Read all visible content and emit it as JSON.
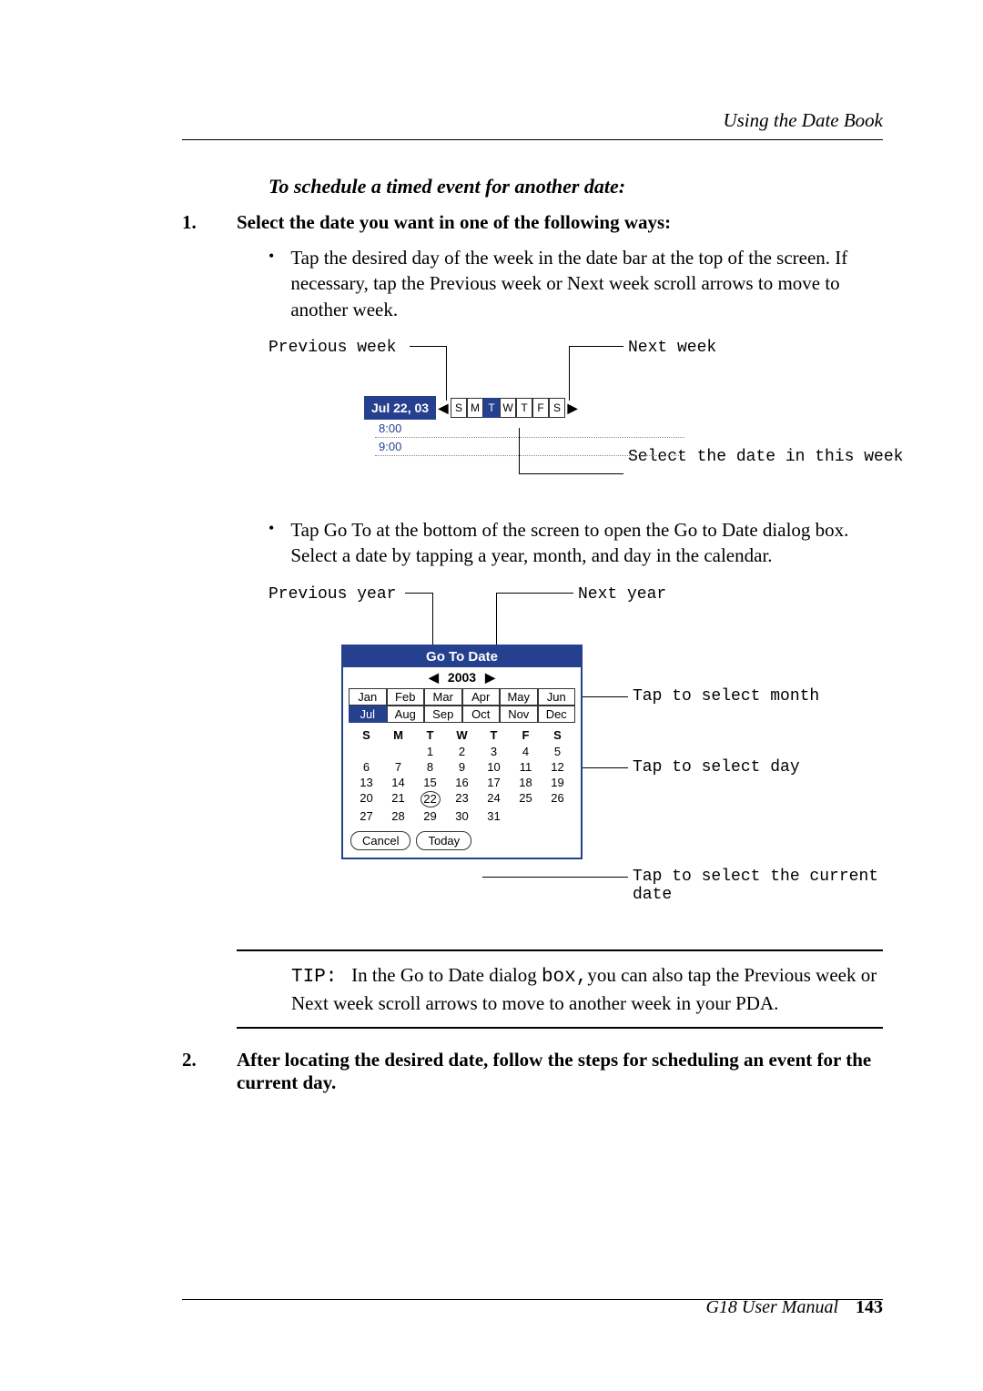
{
  "header": {
    "running_head": "Using the Date Book"
  },
  "section": {
    "subhead": "To schedule a timed event for another date:",
    "step1": {
      "num": "1.",
      "text": "Select the date you want in one of the following ways:",
      "bullet1": "Tap the desired day of the week in the date bar at the top of the screen. If necessary, tap the Previous week or Next week scroll arrows to move to another week.",
      "bullet2": "Tap Go To at the bottom of the screen to open the Go to Date dialog box. Select a date by tapping a year, month, and day in the calendar."
    },
    "step2": {
      "num": "2.",
      "text": "After locating the desired date, follow the steps for scheduling an event for the current day."
    }
  },
  "fig1": {
    "prev_week": "Previous week",
    "next_week": "Next week",
    "date_chip": "Jul 22, 03",
    "days": [
      "S",
      "M",
      "T",
      "W",
      "T",
      "F",
      "S"
    ],
    "selected_day_index": 2,
    "times": [
      "8:00",
      "9:00"
    ],
    "callout": "Select the date in this week"
  },
  "fig2": {
    "prev_year": "Previous year",
    "next_year": "Next year",
    "panel_title": "Go To Date",
    "year": "2003",
    "months_row1": [
      "Jan",
      "Feb",
      "Mar",
      "Apr",
      "May",
      "Jun"
    ],
    "months_row2": [
      "Jul",
      "Aug",
      "Sep",
      "Oct",
      "Nov",
      "Dec"
    ],
    "selected_month": "Jul",
    "dow": [
      "S",
      "M",
      "T",
      "W",
      "T",
      "F",
      "S"
    ],
    "weeks": [
      [
        "",
        "",
        "1",
        "2",
        "3",
        "4",
        "5"
      ],
      [
        "6",
        "7",
        "8",
        "9",
        "10",
        "11",
        "12"
      ],
      [
        "13",
        "14",
        "15",
        "16",
        "17",
        "18",
        "19"
      ],
      [
        "20",
        "21",
        "22",
        "23",
        "24",
        "25",
        "26"
      ],
      [
        "27",
        "28",
        "29",
        "30",
        "31",
        "",
        ""
      ]
    ],
    "selected_day": "22",
    "btn_cancel": "Cancel",
    "btn_today": "Today",
    "callout_month": "Tap to select month",
    "callout_day": "Tap to select day",
    "callout_today": "Tap to select the current date"
  },
  "tip": {
    "label": "TIP:",
    "box_word": "box,",
    "pre": "In the Go to Date dialog ",
    "post": "you can also tap the Previous week or Next week scroll arrows to move to another week in your PDA."
  },
  "footer": {
    "text": "G18 User Manual",
    "page": "143"
  }
}
